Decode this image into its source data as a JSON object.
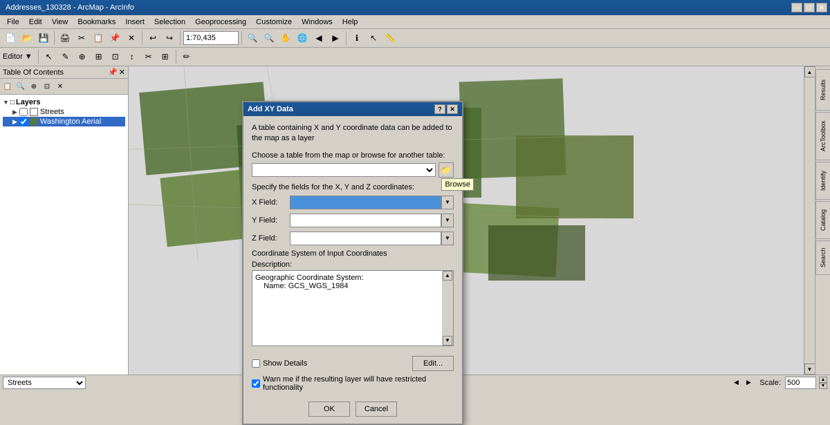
{
  "titlebar": {
    "title": "Addresses_130328 - ArcMap - ArcInfo",
    "min": "—",
    "max": "□",
    "close": "✕"
  },
  "menubar": {
    "items": [
      "File",
      "Edit",
      "View",
      "Bookmarks",
      "Insert",
      "Selection",
      "Geoprocessing",
      "Customize",
      "Windows",
      "Help"
    ]
  },
  "toolbar": {
    "scale": "1:70,435"
  },
  "toc": {
    "header": "Table Of Contents",
    "pin": "📌",
    "close": "✕",
    "layers_label": "Layers",
    "layers": [
      {
        "name": "Streets",
        "checked": false
      },
      {
        "name": "Washington Aerial",
        "checked": true,
        "selected": true
      }
    ]
  },
  "statusbar": {
    "streets_dropdown": "Streets",
    "scale_value": "500"
  },
  "dialog": {
    "title": "Add XY Data",
    "help_btn": "?",
    "close_btn": "✕",
    "intro": "A table containing X and Y coordinate data can be added to the map as a layer",
    "table_label": "Choose a table from the map or browse for another table:",
    "browse_tooltip": "Browse",
    "fields_label": "Specify the fields for the X, Y and Z coordinates:",
    "x_field_label": "X Field:",
    "y_field_label": "Y Field:",
    "z_field_label": "Z Field:",
    "coord_system_label": "Coordinate System of Input Coordinates",
    "desc_label": "Description:",
    "desc_text": "Geographic Coordinate System:\n    Name: GCS_WGS_1984",
    "show_details_label": "Show Details",
    "edit_btn": "Edit...",
    "warn_label": "Warn me if the resulting layer will have restricted functionality",
    "ok_btn": "OK",
    "cancel_btn": "Cancel"
  },
  "right_tabs": {
    "results": "Results",
    "arctoolbox": "ArcToolbox",
    "identify": "Identify",
    "catalog": "Catalog",
    "search": "Search"
  }
}
